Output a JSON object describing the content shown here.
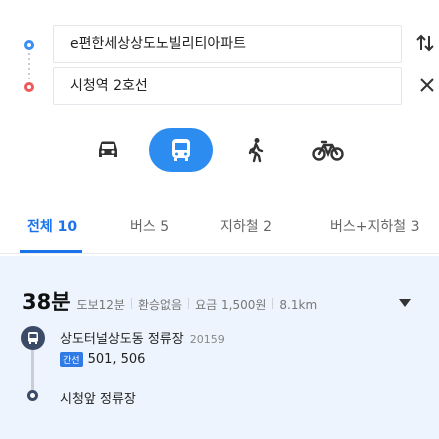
{
  "route": {
    "start": "e편한세상상도노빌리티아파트",
    "end": "시청역 2호선",
    "swap_icon": "swap-vertical-icon",
    "clear_icon": "close-icon"
  },
  "modes": {
    "items": [
      "car",
      "bus",
      "walk",
      "bicycle"
    ],
    "active": "bus",
    "active_color": "#2d8cf0"
  },
  "tabs": [
    {
      "label": "전체 10",
      "active": true
    },
    {
      "label": "버스 5",
      "active": false
    },
    {
      "label": "지하철 2",
      "active": false
    },
    {
      "label": "버스+지하철 3",
      "active": false
    }
  ],
  "result": {
    "time": "38분",
    "walk": "도보12분",
    "transfer": "환승없음",
    "fare": "요금 1,500원",
    "distance": "8.1km",
    "board_stop": "상도터널상도동 정류장",
    "board_stop_code": "20159",
    "bus_type_badge": "간선",
    "bus_numbers": "501, 506",
    "alight_stop": "시청앞 정류장",
    "bus_badge_color": "#2f7ae5"
  }
}
